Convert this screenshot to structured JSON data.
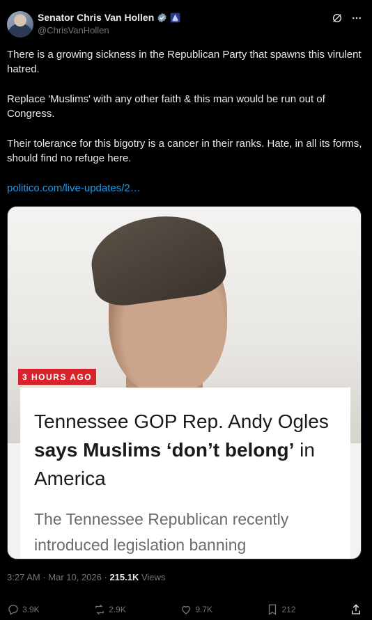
{
  "author": {
    "name": "Senator Chris Van Hollen",
    "handle": "@ChrisVanHollen"
  },
  "tweet": {
    "paragraphs": [
      "There is a growing sickness in the Republican Party that spawns this virulent hatred.",
      "Replace 'Muslims' with any other faith & this man would be run out of Congress.",
      "Their tolerance for this bigotry is a cancer in their ranks. Hate, in all its forms, should find no refuge here."
    ],
    "link": "politico.com/live-updates/2…"
  },
  "card": {
    "time_badge": "3 HOURS AGO",
    "headline_plain_1": "Tennessee GOP Rep. Andy Ogles ",
    "headline_bold_1": "says Muslims ‘don’t belong’",
    "headline_plain_2": " in America",
    "subhead": "The Tennessee Republican recently introduced legislation banning"
  },
  "meta": {
    "time": "3:27 AM",
    "separator": " · ",
    "date": "Mar 10, 2026",
    "views_count": "215.1K",
    "views_label": " Views"
  },
  "actions": {
    "replies": "3.9K",
    "reposts": "2.9K",
    "likes": "9.7K",
    "bookmarks": "212"
  },
  "colors": {
    "background": "#000000",
    "link": "#1d9bf0",
    "verified_badge": "#829aab",
    "time_badge": "#d7232b"
  }
}
